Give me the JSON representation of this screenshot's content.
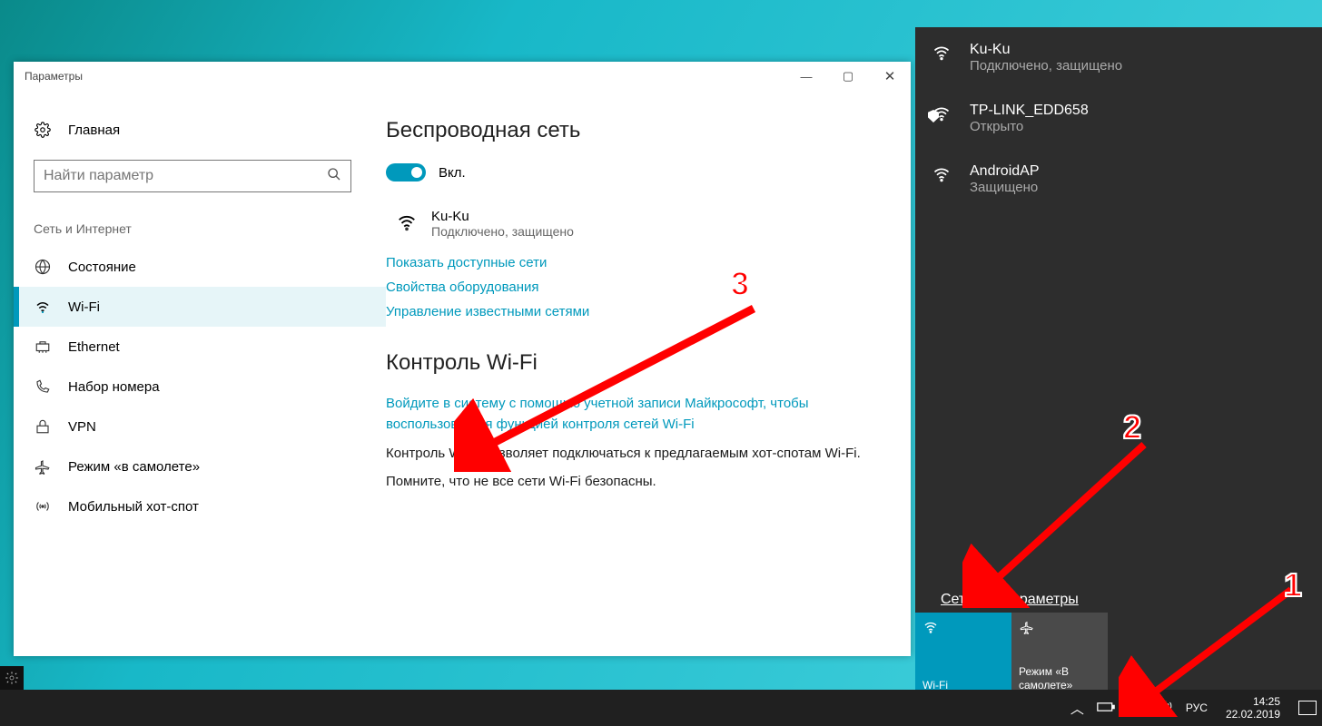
{
  "settings": {
    "title": "Параметры",
    "home": "Главная",
    "search_placeholder": "Найти параметр",
    "group": "Сеть и Интернет",
    "nav": [
      {
        "label": "Состояние"
      },
      {
        "label": "Wi-Fi"
      },
      {
        "label": "Ethernet"
      },
      {
        "label": "Набор номера"
      },
      {
        "label": "VPN"
      },
      {
        "label": "Режим «в самолете»"
      },
      {
        "label": "Мобильный хот-спот"
      }
    ],
    "content": {
      "h1": "Беспроводная сеть",
      "toggle_label": "Вкл.",
      "network": {
        "ssid": "Ku-Ku",
        "status": "Подключено, защищено"
      },
      "links": {
        "available": "Показать доступные сети",
        "hardware": "Свойства оборудования",
        "manage": "Управление известными сетями"
      },
      "h2": "Контроль Wi-Fi",
      "signin_link": "Войдите в систему с помощью учетной записи Майкрософт, чтобы воспользоваться функцией контроля сетей Wi-Fi",
      "p1": "Контроль Wi-Fi позволяет подключаться к предлагаемым хот-спотам Wi-Fi.",
      "p2": "Помните, что не все сети Wi-Fi безопасны."
    }
  },
  "flyout": {
    "networks": [
      {
        "ssid": "Ku-Ku",
        "status": "Подключено, защищено",
        "shield": false
      },
      {
        "ssid": "TP-LINK_EDD658",
        "status": "Открыто",
        "shield": true
      },
      {
        "ssid": "AndroidAP",
        "status": "Защищено",
        "shield": false
      }
    ],
    "settings_link": "Сетевые параметры",
    "tiles": {
      "wifi": "Wi-Fi",
      "airplane": "Режим «В самолете»"
    }
  },
  "taskbar": {
    "lang": "РУС",
    "time": "14:25",
    "date": "22.02.2019"
  },
  "annotations": {
    "n1": "1",
    "n2": "2",
    "n3": "3"
  }
}
